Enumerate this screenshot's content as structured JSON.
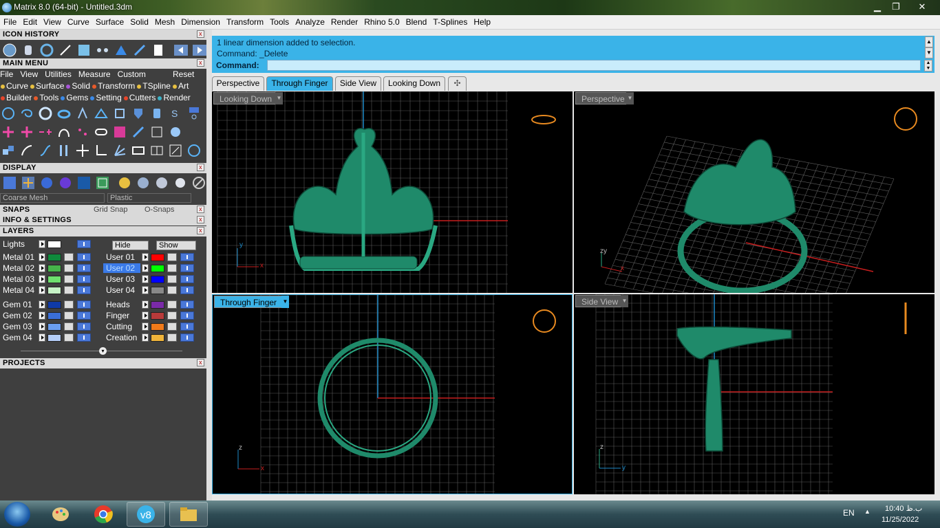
{
  "window": {
    "title": "Matrix 8.0 (64-bit) - Untitled.3dm",
    "minimize_glyph": "▁",
    "maximize_glyph": "❐",
    "close_glyph": "✕"
  },
  "menu": [
    "File",
    "Edit",
    "View",
    "Curve",
    "Surface",
    "Solid",
    "Mesh",
    "Dimension",
    "Transform",
    "Tools",
    "Analyze",
    "Render",
    "Rhino 5.0",
    "Blend",
    "T-Splines",
    "Help"
  ],
  "panels": {
    "icon_history": "ICON HISTORY",
    "main_menu": "MAIN MENU",
    "display": "DISPLAY",
    "snaps": "SNAPS",
    "info_settings": "INFO & SETTINGS",
    "layers": "LAYERS",
    "projects": "PROJECTS"
  },
  "main_menu_bar": [
    "File",
    "View",
    "Utilities",
    "Measure",
    "Custom"
  ],
  "main_menu_reset": "Reset",
  "builder_tabs_row1": [
    {
      "label": "Curve",
      "color": "#e8c040"
    },
    {
      "label": "Surface",
      "color": "#e8c040"
    },
    {
      "label": "Solid",
      "color": "#a855d8"
    },
    {
      "label": "Transform",
      "color": "#e85a2a"
    },
    {
      "label": "TSpline",
      "color": "#e8c040"
    },
    {
      "label": "Art",
      "color": "#e8c040"
    }
  ],
  "builder_tabs_row2": [
    {
      "label": "Builder",
      "color": "#e8452a"
    },
    {
      "label": "Tools",
      "color": "#e85a2a"
    },
    {
      "label": "Gems",
      "color": "#3a8ae8"
    },
    {
      "label": "Setting",
      "color": "#3a8ae8"
    },
    {
      "label": "Cutters",
      "color": "#e8452a"
    },
    {
      "label": "Render",
      "color": "#3ab3c8"
    }
  ],
  "display": {
    "mesh_select": "Coarse Mesh",
    "material_select": "Plastic"
  },
  "snaps": {
    "grid_snap": "Grid Snap",
    "osnaps": "O-Snaps"
  },
  "layers": {
    "lights_label": "Lights",
    "hide": "Hide",
    "show": "Show",
    "left": [
      {
        "name": "Metal 01",
        "color": "#0f8a3c"
      },
      {
        "name": "Metal 02",
        "color": "#46b34a"
      },
      {
        "name": "Metal 03",
        "color": "#6ee06e"
      },
      {
        "name": "Metal 04",
        "color": "#c6f2c6"
      }
    ],
    "right": [
      {
        "name": "User 01",
        "color": "#ff0000"
      },
      {
        "name": "User 02",
        "color": "#00ff00"
      },
      {
        "name": "User 03",
        "color": "#0000ff"
      },
      {
        "name": "User 04",
        "color": "#888888"
      }
    ],
    "gems_left": [
      {
        "name": "Gem 01",
        "color": "#0f3aa8"
      },
      {
        "name": "Gem 02",
        "color": "#3a6ed8"
      },
      {
        "name": "Gem 03",
        "color": "#6a9ef0"
      },
      {
        "name": "Gem 04",
        "color": "#b4cdf7"
      }
    ],
    "gems_right": [
      {
        "name": "Heads",
        "color": "#7a2aa8"
      },
      {
        "name": "Finger",
        "color": "#b83a3a"
      },
      {
        "name": "Cutting",
        "color": "#f07a1a"
      },
      {
        "name": "Creation",
        "color": "#f0b43a"
      }
    ],
    "selected": "User 02"
  },
  "command": {
    "history": [
      "1 linear dimension added to selection.",
      "Command: _Delete"
    ],
    "label": "Command:",
    "value": ""
  },
  "tabs": [
    {
      "label": "Perspective",
      "active": false
    },
    {
      "label": "Through Finger",
      "active": true
    },
    {
      "label": "Side View",
      "active": false
    },
    {
      "label": "Looking Down",
      "active": false
    }
  ],
  "tab_add_glyph": "✣",
  "viewports": [
    {
      "label": "Looking Down",
      "active": false,
      "axis_v": "y",
      "axis_h": "x"
    },
    {
      "label": "Perspective",
      "active": false,
      "axis_v": "zy",
      "axis_h": "x"
    },
    {
      "label": "Through Finger",
      "active": true,
      "axis_v": "z",
      "axis_h": "x"
    },
    {
      "label": "Side View",
      "active": false,
      "axis_v": "z",
      "axis_h": "y"
    }
  ],
  "tray": {
    "lang": "EN",
    "time": "10:40 ب.ظ",
    "date": "11/25/2022"
  },
  "colors": {
    "model": "#1f8a6a",
    "command_bg": "#3ab3e8",
    "axis_red": "#c81e1e",
    "axis_blue": "#1e8ac8"
  }
}
